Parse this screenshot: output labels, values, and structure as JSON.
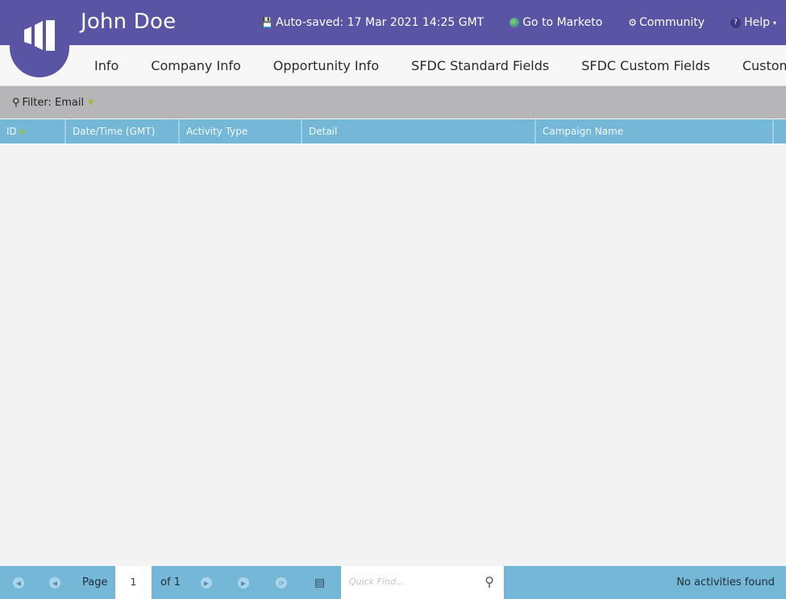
{
  "header": {
    "title": "John Doe",
    "links": [
      {
        "icon": "save-icon",
        "label": "Auto-saved: 17 Mar 2021 14:25 GMT"
      },
      {
        "icon": "globe-icon",
        "label": "Go to Marketo"
      },
      {
        "icon": "community-icon",
        "label": "Community"
      },
      {
        "icon": "help-icon",
        "label": "Help"
      }
    ],
    "colors": {
      "brand": "#5a54a5"
    }
  },
  "tabs": [
    "Info",
    "Company Info",
    "Opportunity Info",
    "SFDC Standard Fields",
    "SFDC Custom Fields",
    "Custom Ob"
  ],
  "filter": {
    "label": "Filter: Email"
  },
  "table": {
    "columns": [
      "ID",
      "Date/Time (GMT)",
      "Activity Type",
      "Detail",
      "Campaign Name"
    ],
    "rows": []
  },
  "footer": {
    "page_label": "Page",
    "page_value": "1",
    "of_label": "of 1",
    "quick_find_placeholder": "Quick Find...",
    "status": "No activities found",
    "colors": {
      "bar": "#74b7d6"
    }
  }
}
